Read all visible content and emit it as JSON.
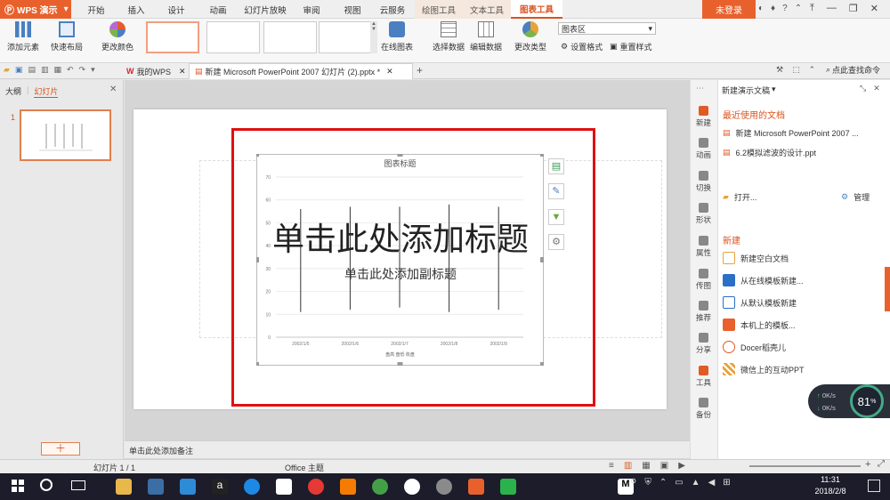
{
  "app": {
    "brand": "WPS 演示",
    "login": "未登录"
  },
  "menu_tabs": [
    "开始",
    "插入",
    "设计",
    "动画",
    "幻灯片放映",
    "审阅",
    "视图",
    "云服务"
  ],
  "context_tabs": [
    "绘图工具",
    "文本工具",
    "图表工具"
  ],
  "active_context_tab": "图表工具",
  "ribbon": {
    "add_element": "添加元素",
    "quick_layout": "快速布局",
    "change_color": "更改颜色",
    "online_chart": "在线图表",
    "select_data": "选择数据",
    "edit_data": "编辑数据",
    "change_type": "更改类型",
    "chart_area_select": "图表区",
    "set_format": "设置格式",
    "reset_style": "重置样式"
  },
  "doc_tabs": [
    {
      "label": "我的WPS"
    },
    {
      "label": "新建 Microsoft PowerPoint 2007 幻灯片 (2).pptx *"
    }
  ],
  "quick_search": "点此查找命令",
  "left_pane": {
    "tab_outline": "大纲",
    "tab_slides": "幻灯片",
    "slide_number": "1"
  },
  "slide": {
    "title_placeholder": "单击此处添加标题",
    "subtitle_placeholder": "单击此处添加副标题",
    "notes_placeholder": "单击此处添加备注"
  },
  "chart_data": {
    "type": "bar",
    "title": "图表标题",
    "categories": [
      "2002/1/5",
      "2002/1/6",
      "2002/1/7",
      "2002/1/8",
      "2002/1/9"
    ],
    "y_ticks": [
      0,
      10,
      20,
      30,
      40,
      50,
      60,
      70
    ],
    "ylim": [
      0,
      70
    ],
    "legend": "盘高 盘低 收盘",
    "series": [
      {
        "values": [
          56,
          57,
          57,
          58,
          57
        ]
      },
      {
        "values": [
          11,
          12,
          13,
          11,
          12
        ]
      }
    ],
    "grid": true
  },
  "task_pane": {
    "title": "新建演示文稿",
    "recent_header": "最近使用的文档",
    "recent_files": [
      "新建 Microsoft PowerPoint 2007 ...",
      "6.2模拟滤波的设计.ppt"
    ],
    "open": "打开...",
    "manage": "管理",
    "new_header": "新建",
    "new_items": [
      "新建空白文档",
      "从在线模板新建...",
      "从默认模板新建",
      "本机上的模板...",
      "Docer稻壳儿",
      "微信上的互动PPT"
    ]
  },
  "side_strip": [
    "新建",
    "动画",
    "切换",
    "形状",
    "属性",
    "传图",
    "推荐",
    "分享",
    "工具",
    "备份"
  ],
  "status": {
    "slide_counter": "幻灯片 1 / 1",
    "theme": "Office 主题"
  },
  "net_widget": {
    "up": "0K/s",
    "down": "0K/s",
    "percent": "81",
    "percent_unit": "%"
  },
  "taskbar": {
    "time": "11:31",
    "date": "2018/2/8"
  }
}
